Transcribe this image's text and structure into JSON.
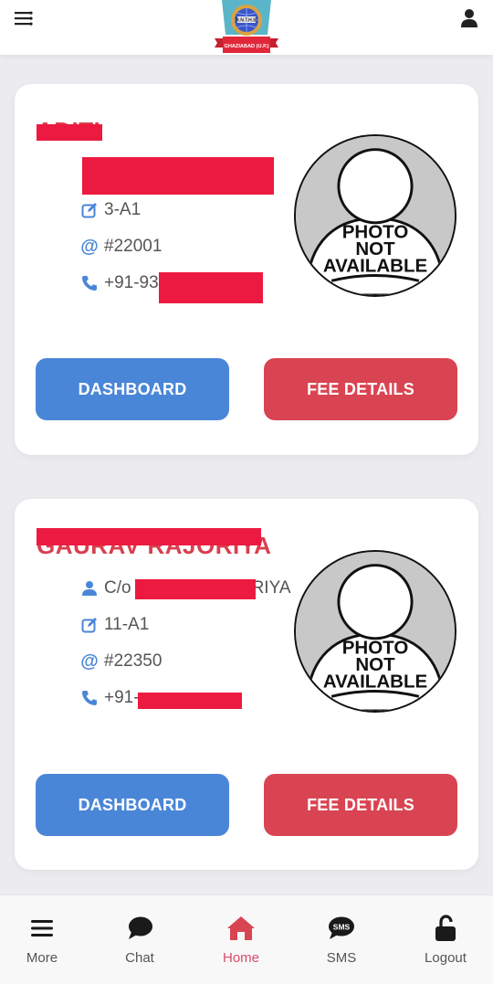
{
  "header": {
    "logo_text": "R.N.T.H.S.",
    "logo_subtext": "GHAZIABAD (U.P.)",
    "menu_icon": "menu-lines-icon",
    "profile_icon": "user-icon"
  },
  "colors": {
    "name": "#d93f4f",
    "redaction": "#ec1a40",
    "primary_blue": "#4a86d8",
    "danger_red": "#d94452",
    "active_nav": "#d94d6a"
  },
  "students": [
    {
      "name": "ADITI",
      "guardian": "",
      "class": "3-A1",
      "admission_no": "#22001",
      "phone": "+91-93",
      "photo_text": [
        "PHOTO",
        "NOT",
        "AVAILABLE"
      ],
      "dashboard_label": "DASHBOARD",
      "fee_label": "FEE DETAILS"
    },
    {
      "name": "GAURAV RAJORIYA",
      "guardian": "C/o ",
      "guardian_suffix": "RIYA",
      "class": "11-A1",
      "admission_no": "#22350",
      "phone": "+91-",
      "photo_text": [
        "PHOTO",
        "NOT",
        "AVAILABLE"
      ],
      "dashboard_label": "DASHBOARD",
      "fee_label": "FEE DETAILS"
    }
  ],
  "bottom_nav": [
    {
      "label": "More",
      "icon": "hamburger-icon",
      "active": false
    },
    {
      "label": "Chat",
      "icon": "chat-bubble-icon",
      "active": false
    },
    {
      "label": "Home",
      "icon": "home-icon",
      "active": true
    },
    {
      "label": "SMS",
      "icon": "sms-bubble-icon",
      "active": false
    },
    {
      "label": "Logout",
      "icon": "unlock-icon",
      "active": false
    }
  ]
}
